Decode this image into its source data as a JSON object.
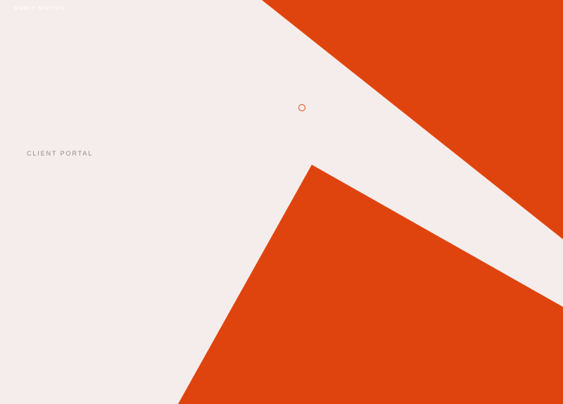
{
  "header": {
    "brand": "MANLY MOTION"
  },
  "nav": {
    "client_portal_label": "CLIENT PORTAL"
  },
  "colors": {
    "background": "#f5edeb",
    "accent": "#e0440e",
    "muted_text": "#8e8a89"
  },
  "icons": {
    "cursor": "cursor-ring-icon"
  }
}
